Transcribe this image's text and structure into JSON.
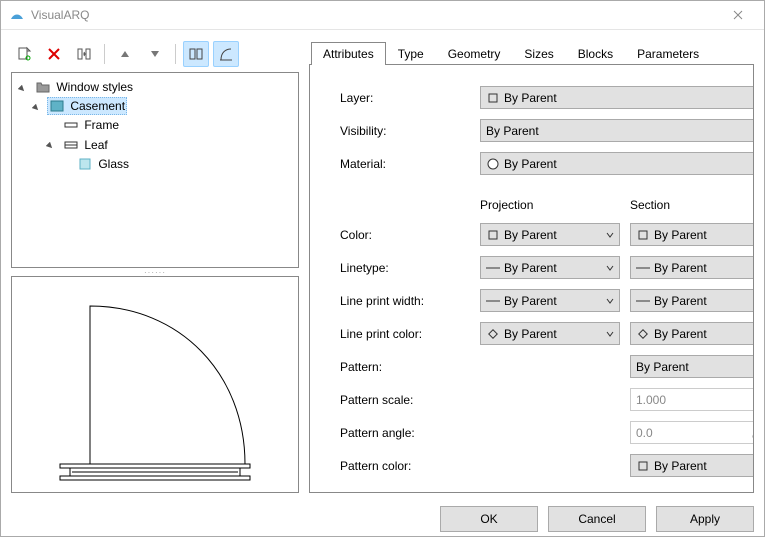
{
  "window": {
    "title": "VisualARQ"
  },
  "tree": {
    "root": "Window styles",
    "n0": "Casement",
    "n0_0": "Frame",
    "n0_1": "Leaf",
    "n0_1_0": "Glass"
  },
  "tabs": {
    "attributes": "Attributes",
    "type": "Type",
    "geometry": "Geometry",
    "sizes": "Sizes",
    "blocks": "Blocks",
    "parameters": "Parameters"
  },
  "labels": {
    "layer": "Layer:",
    "visibility": "Visibility:",
    "material": "Material:",
    "projection": "Projection",
    "section": "Section",
    "color": "Color:",
    "linetype": "Linetype:",
    "lineprintwidth": "Line print width:",
    "lineprintcolor": "Line print color:",
    "pattern": "Pattern:",
    "patternscale": "Pattern scale:",
    "patternangle": "Pattern angle:",
    "patterncolor": "Pattern color:"
  },
  "values": {
    "by_parent": "By Parent",
    "dash_by_parent": "By Parent",
    "pattern_scale": "1.000",
    "pattern_angle": "0.0"
  },
  "footer": {
    "ok": "OK",
    "cancel": "Cancel",
    "apply": "Apply"
  }
}
